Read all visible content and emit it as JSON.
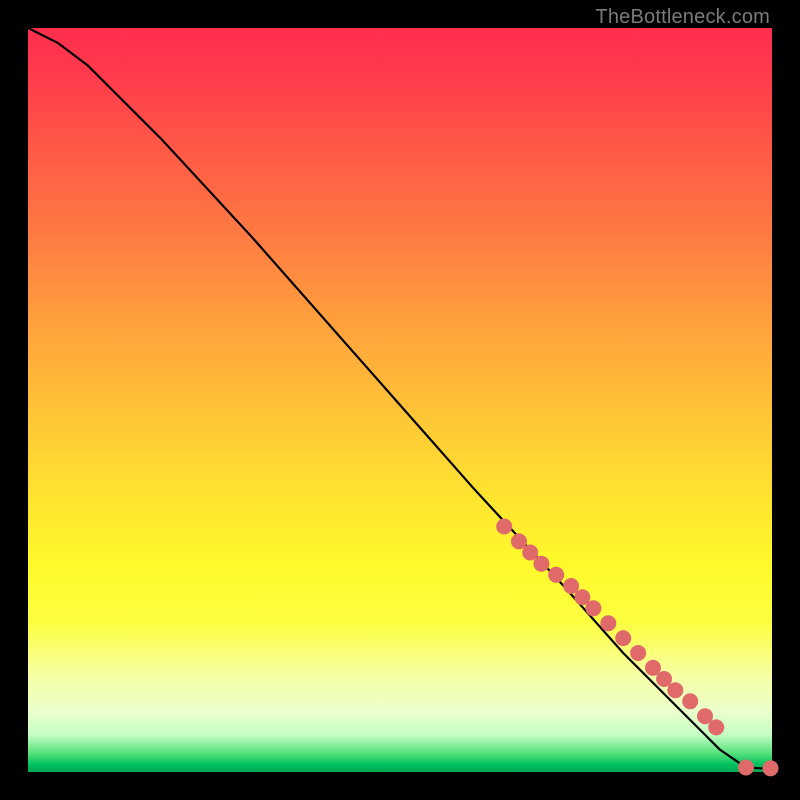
{
  "attribution": "TheBottleneck.com",
  "chart_data": {
    "type": "line",
    "title": "",
    "xlabel": "",
    "ylabel": "",
    "xlim": [
      0,
      100
    ],
    "ylim": [
      0,
      100
    ],
    "grid": false,
    "legend": false,
    "series": [
      {
        "name": "curve",
        "kind": "line",
        "x": [
          0,
          4,
          8,
          12,
          18,
          30,
          45,
          60,
          72,
          80,
          88,
          93,
          96.5,
          98.5,
          100
        ],
        "y": [
          100,
          98,
          95,
          91,
          85,
          72,
          55,
          38,
          25,
          16,
          8,
          3,
          0.6,
          0.5,
          0.5
        ]
      },
      {
        "name": "points",
        "kind": "scatter",
        "x": [
          64,
          66,
          67.5,
          69,
          71,
          73,
          74.5,
          76,
          78,
          80,
          82,
          84,
          85.5,
          87,
          89,
          91,
          92.5,
          96.5,
          99.8
        ],
        "y": [
          33,
          31,
          29.5,
          28,
          26.5,
          25,
          23.5,
          22,
          20,
          18,
          16,
          14,
          12.5,
          11,
          9.5,
          7.5,
          6,
          0.6,
          0.5
        ]
      }
    ]
  }
}
